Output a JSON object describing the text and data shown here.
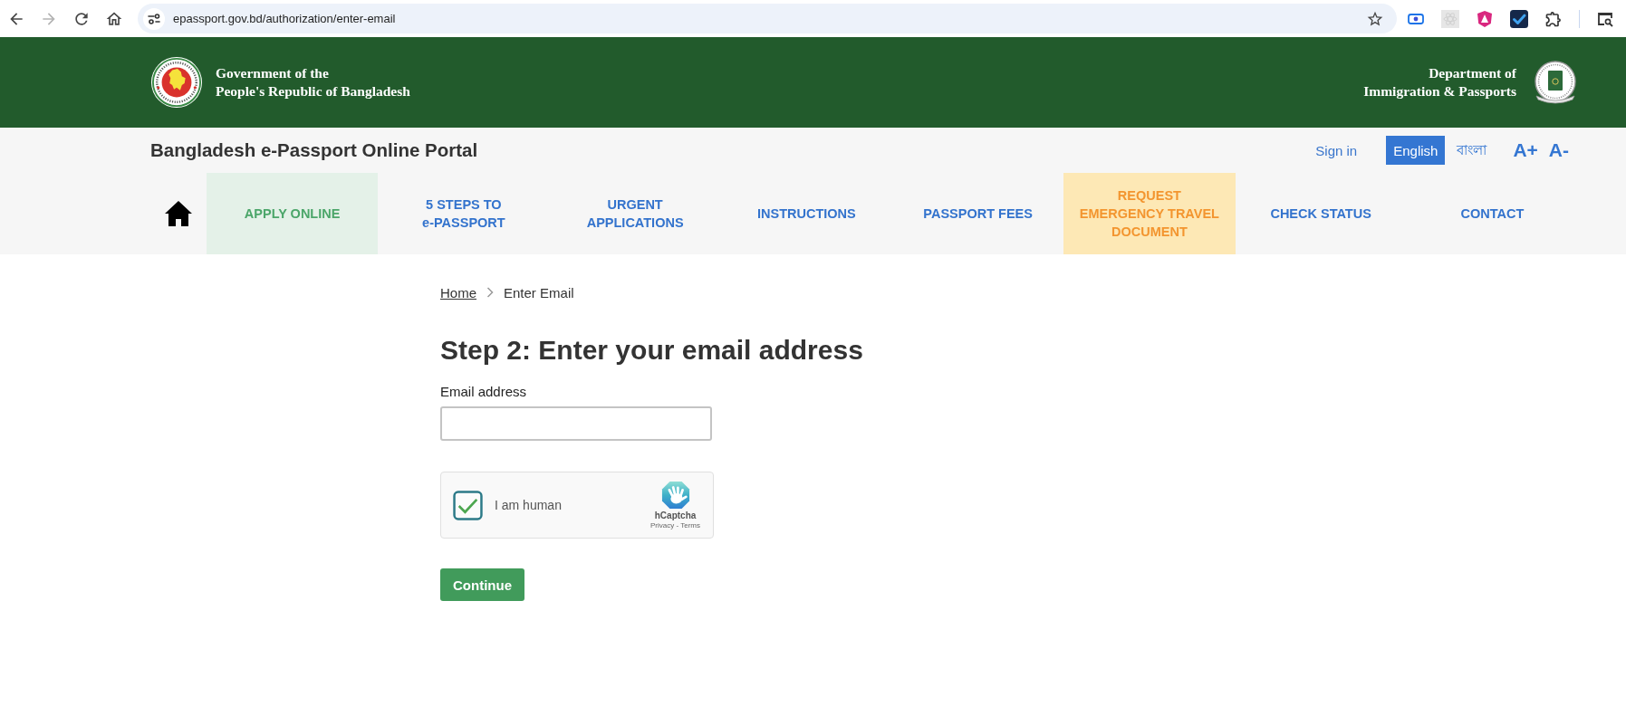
{
  "browser": {
    "url": "epassport.gov.bd/authorization/enter-email",
    "forward_disabled": true
  },
  "header": {
    "left_title": "Government of the\nPeople's Republic of Bangladesh",
    "right_title": "Department of\nImmigration & Passports"
  },
  "portal_bar": {
    "title": "Bangladesh e-Passport Online Portal",
    "sign_in": "Sign in",
    "languages": [
      {
        "label": "English",
        "selected": true
      },
      {
        "label": "বাংলা",
        "selected": false
      }
    ],
    "font_size_buttons": [
      "A+",
      "A-"
    ]
  },
  "nav": {
    "items": [
      {
        "label": "APPLY ONLINE",
        "kind": "link",
        "selected": true
      },
      {
        "label": "5 STEPS TO\ne-PASSPORT",
        "kind": "link",
        "selected": false
      },
      {
        "label": "URGENT\nAPPLICATIONS",
        "kind": "link",
        "selected": false
      },
      {
        "label": "INSTRUCTIONS",
        "kind": "link",
        "selected": false
      },
      {
        "label": "PASSPORT FEES",
        "kind": "link",
        "selected": false
      },
      {
        "label": "REQUEST\nEMERGENCY TRAVEL\nDOCUMENT",
        "kind": "featured",
        "selected": false
      },
      {
        "label": "CHECK STATUS",
        "kind": "link",
        "selected": false
      },
      {
        "label": "CONTACT",
        "kind": "link",
        "selected": false
      }
    ]
  },
  "breadcrumb": [
    {
      "label": "Home",
      "kind": "link"
    },
    {
      "label": "Enter Email",
      "kind": "current"
    }
  ],
  "form": {
    "heading": "Step 2: Enter your email address",
    "email_label": "Email address",
    "captcha": {
      "label": "I am human",
      "checked": true,
      "brand": "hCaptcha",
      "footer": "Privacy - Terms"
    },
    "submit_button": "Continue"
  }
}
